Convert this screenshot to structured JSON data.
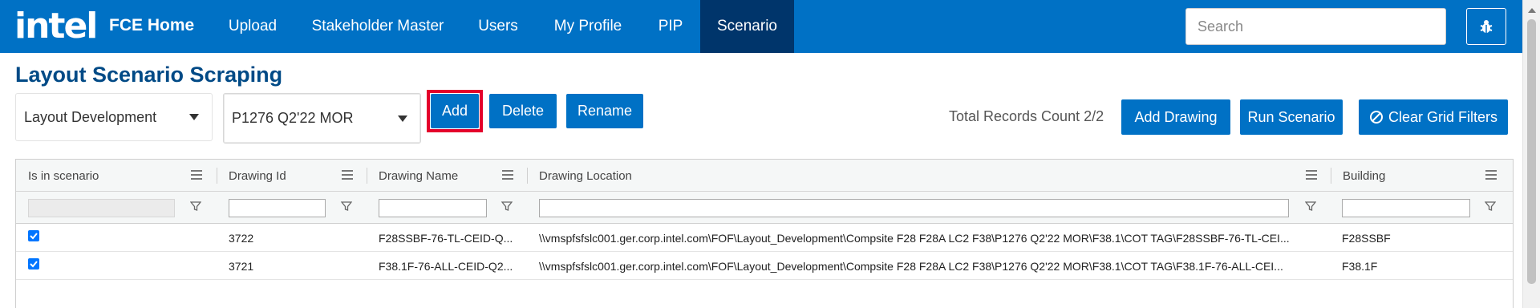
{
  "brand": {
    "logo": "intel",
    "title": "FCE Home"
  },
  "nav": {
    "items": [
      {
        "label": "Upload"
      },
      {
        "label": "Stakeholder Master"
      },
      {
        "label": "Users"
      },
      {
        "label": "My Profile"
      },
      {
        "label": "PIP"
      },
      {
        "label": "Scenario",
        "active": true
      }
    ],
    "search_placeholder": "Search",
    "bug_icon": "bug-icon"
  },
  "page": {
    "title": "Layout Scenario Scraping"
  },
  "toolbar": {
    "select1_value": "Layout Development",
    "select2_value": "P1276 Q2'22 MOR",
    "add_label": "Add",
    "delete_label": "Delete",
    "rename_label": "Rename",
    "total_records": "Total Records Count 2/2",
    "add_drawing_label": "Add Drawing",
    "run_scenario_label": "Run Scenario",
    "clear_filters_label": "Clear Grid Filters"
  },
  "grid": {
    "columns": [
      "Is in scenario",
      "Drawing Id",
      "Drawing Name",
      "Drawing Location",
      "Building"
    ],
    "rows": [
      {
        "checked": true,
        "id": "3722",
        "name": "F28SSBF-76-TL-CEID-Q...",
        "location": "\\\\vmspfsfslc001.ger.corp.intel.com\\FOF\\Layout_Development\\Compsite F28 F28A LC2 F38\\P1276 Q2'22 MOR\\F38.1\\COT TAG\\F28SSBF-76-TL-CEI...",
        "building": "F28SSBF"
      },
      {
        "checked": true,
        "id": "3721",
        "name": "F38.1F-76-ALL-CEID-Q2...",
        "location": "\\\\vmspfsfslc001.ger.corp.intel.com\\FOF\\Layout_Development\\Compsite F28 F28A LC2 F38\\P1276 Q2'22 MOR\\F38.1\\COT TAG\\F38.1F-76-ALL-CEI...",
        "building": "F38.1F"
      }
    ]
  },
  "colors": {
    "nav_bg": "#0071c5",
    "nav_active": "#00356b",
    "title": "#004a86",
    "add_highlight": "#e4002b"
  }
}
